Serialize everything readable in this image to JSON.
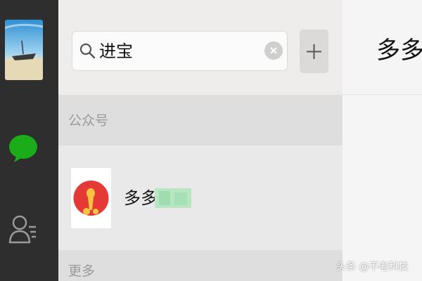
{
  "search": {
    "value": "进宝"
  },
  "sections": {
    "public_accounts": "公众号",
    "more": "更多"
  },
  "results": [
    {
      "name": "多多"
    }
  ],
  "chat": {
    "title": "多多"
  },
  "watermark": "头条 @不老科技",
  "colors": {
    "navbar": "#2e2e2e",
    "chat_icon": "#1aad19",
    "panel": "#e7e7e7",
    "section_header": "#dedede"
  },
  "icons": [
    "chat-icon",
    "contacts-icon",
    "search-icon",
    "clear-icon",
    "plus-icon"
  ]
}
